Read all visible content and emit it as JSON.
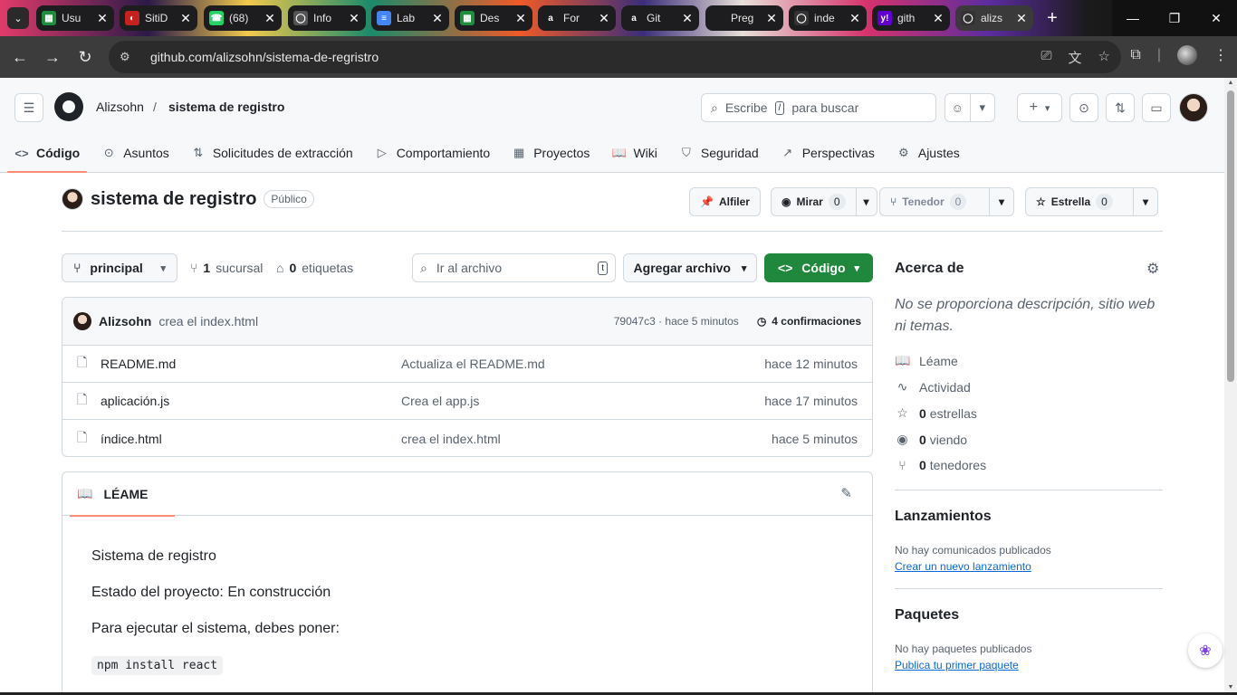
{
  "browser": {
    "tabs": [
      {
        "title": "Usu",
        "fav_color": "#1e8e3e",
        "fav": "▦"
      },
      {
        "title": "SitiD",
        "fav_color": "#c5221f",
        "fav": "◐"
      },
      {
        "title": "(68)",
        "fav_color": "#25d366",
        "fav": "☎"
      },
      {
        "title": "Info",
        "fav_color": "#555555",
        "fav": "◯"
      },
      {
        "title": "Lab",
        "fav_color": "#4285f4",
        "fav": "≡"
      },
      {
        "title": "Des",
        "fav_color": "#1e8e3e",
        "fav": "▦"
      },
      {
        "title": "For",
        "fav_color": "#1d1d1f",
        "fav": "a"
      },
      {
        "title": "Git",
        "fav_color": "#1d1d1f",
        "fav": "a"
      },
      {
        "title": "Preg",
        "fav_color": "#1d1d1f",
        "fav": ""
      },
      {
        "title": "inde",
        "fav_color": "#333333",
        "fav": "◯"
      },
      {
        "title": "gith",
        "fav_color": "#6001d2",
        "fav": "y!"
      },
      {
        "title": "alizs",
        "fav_color": "#333333",
        "fav": "◯"
      }
    ],
    "url": "github.com/alizsohn/sistema-de-regristro"
  },
  "header": {
    "owner": "Alizsohn",
    "separator": "/",
    "repo": "sistema de registro",
    "search_pre": "Escribe",
    "search_key": "/",
    "search_post": "para buscar"
  },
  "repo_nav": [
    {
      "label": "Código",
      "icon": "code-icon",
      "glyph": "<>"
    },
    {
      "label": "Asuntos",
      "icon": "issue-icon",
      "glyph": "⊙"
    },
    {
      "label": "Solicitudes de extracción",
      "icon": "pull-request-icon",
      "glyph": "⇅"
    },
    {
      "label": "Comportamiento",
      "icon": "actions-icon",
      "glyph": "▷"
    },
    {
      "label": "Proyectos",
      "icon": "projects-icon",
      "glyph": "▦"
    },
    {
      "label": "Wiki",
      "icon": "book-icon",
      "glyph": "📖"
    },
    {
      "label": "Seguridad",
      "icon": "shield-icon",
      "glyph": "⛉"
    },
    {
      "label": "Perspectivas",
      "icon": "graph-icon",
      "glyph": "↗"
    },
    {
      "label": "Ajustes",
      "icon": "gear-icon",
      "glyph": "⚙"
    }
  ],
  "repo_header": {
    "name": "sistema de registro",
    "visibility": "Público",
    "pin_label": "Alfiler",
    "watch_label": "Mirar",
    "watch_count": "0",
    "fork_label": "Tenedor",
    "fork_count": "0",
    "star_label": "Estrella",
    "star_count": "0"
  },
  "file_nav": {
    "branch": "principal",
    "branches_count": "1",
    "branches_label": "sucursal",
    "tags_count": "0",
    "tags_label": "etiquetas",
    "goto_placeholder": "Ir al archivo",
    "goto_key": "t",
    "add_file_label": "Agregar archivo",
    "code_label": "Código"
  },
  "latest_commit": {
    "author": "Alizsohn",
    "message": "crea el index.html",
    "hash_time": "79047c3 · hace 5 minutos",
    "commits_label": "4 confirmaciones"
  },
  "files": [
    {
      "name": "README.md",
      "message": "Actualiza el README.md",
      "time": "hace 12 minutos"
    },
    {
      "name": "aplicación.js",
      "message": "Crea el app.js",
      "time": "hace 17 minutos"
    },
    {
      "name": "índice.html",
      "message": "crea el index.html",
      "time": "hace 5 minutos"
    }
  ],
  "readme": {
    "tab_label": "LÉAME",
    "lines": [
      "Sistema de registro",
      "Estado del proyecto: En construcción",
      "Para ejecutar el sistema, debes poner:"
    ],
    "code": "npm install react"
  },
  "sidebar": {
    "about_title": "Acerca de",
    "about_desc": "No se proporciona descripción, sitio web ni temas.",
    "readme_label": "Léame",
    "activity_label": "Actividad",
    "stars_count": "0",
    "stars_label": "estrellas",
    "watching_count": "0",
    "watching_label": "viendo",
    "forks_count": "0",
    "forks_label": "tenedores",
    "releases_title": "Lanzamientos",
    "releases_empty": "No hay comunicados publicados",
    "releases_link": "Crear un nuevo lanzamiento",
    "packages_title": "Paquetes",
    "packages_empty": "No hay paquetes publicados",
    "packages_link": "Publica tu primer paquete"
  }
}
